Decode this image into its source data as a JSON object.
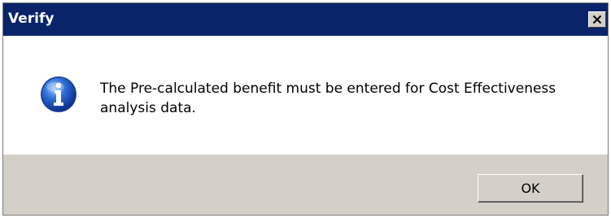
{
  "window": {
    "title": "Verify",
    "titlebar_color": "#0a246a"
  },
  "message": {
    "icon": "information-icon",
    "text": "The Pre-calculated benefit must be entered for Cost Effectiveness analysis data."
  },
  "buttons": {
    "ok_label": "OK",
    "close_icon": "close-icon"
  },
  "colors": {
    "footer_background": "#d4d0c8",
    "content_background": "#ffffff"
  }
}
